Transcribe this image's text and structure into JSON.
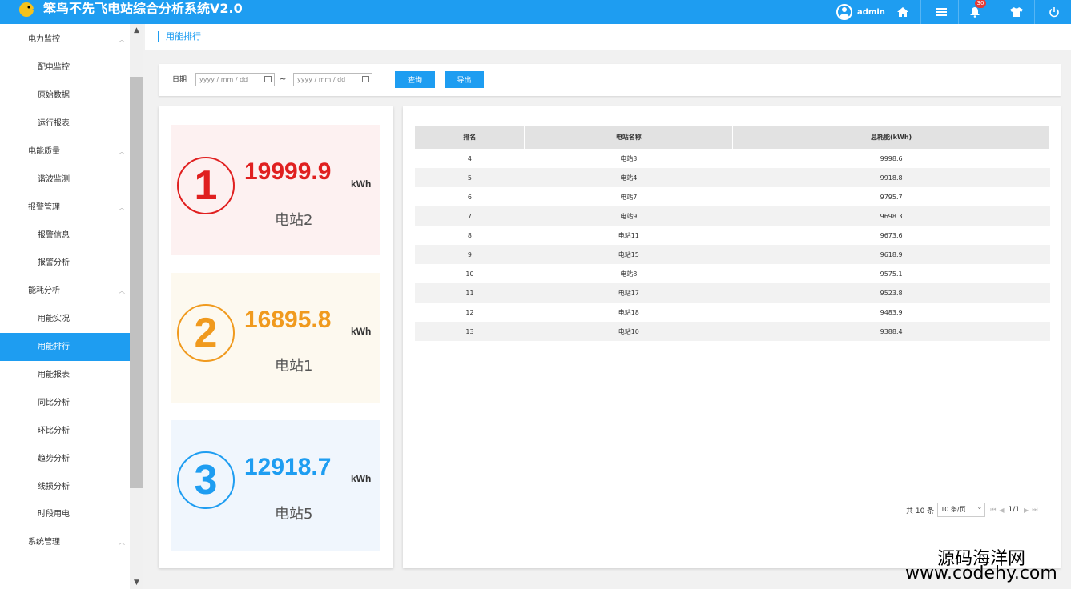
{
  "header": {
    "title": "笨鸟不先飞电站综合分析系统V2.0",
    "username": "admin",
    "notification_count": "30",
    "icons": [
      "logo-bird-icon",
      "user-avatar-icon",
      "home-icon",
      "menu-icon",
      "bell-icon",
      "shirt-icon",
      "power-icon"
    ]
  },
  "sidebar": {
    "items": [
      {
        "label": "电力监控",
        "type": "group"
      },
      {
        "label": "配电监控",
        "type": "item"
      },
      {
        "label": "原始数据",
        "type": "item"
      },
      {
        "label": "运行报表",
        "type": "item"
      },
      {
        "label": "电能质量",
        "type": "group"
      },
      {
        "label": "谐波监测",
        "type": "item"
      },
      {
        "label": "报警管理",
        "type": "group"
      },
      {
        "label": "报警信息",
        "type": "item"
      },
      {
        "label": "报警分析",
        "type": "item"
      },
      {
        "label": "能耗分析",
        "type": "group"
      },
      {
        "label": "用能实况",
        "type": "item"
      },
      {
        "label": "用能排行",
        "type": "item",
        "active": true
      },
      {
        "label": "用能报表",
        "type": "item"
      },
      {
        "label": "同比分析",
        "type": "item"
      },
      {
        "label": "环比分析",
        "type": "item"
      },
      {
        "label": "趋势分析",
        "type": "item"
      },
      {
        "label": "线损分析",
        "type": "item"
      },
      {
        "label": "时段用电",
        "type": "item"
      },
      {
        "label": "系统管理",
        "type": "group"
      }
    ]
  },
  "breadcrumb": "用能排行",
  "filter": {
    "date_label": "日期",
    "start_placeholder": "yyyy / mm / dd",
    "end_placeholder": "yyyy / mm / dd",
    "separator": "~",
    "query_button": "查询",
    "export_button": "导出"
  },
  "top_ranks": [
    {
      "rank": "1",
      "value": "19999.9",
      "unit": "kWh",
      "station": "电站2",
      "color": "#e02020",
      "bg": "#fdf1f1"
    },
    {
      "rank": "2",
      "value": "16895.8",
      "unit": "kWh",
      "station": "电站1",
      "color": "#f09a1e",
      "bg": "#fdf9ef"
    },
    {
      "rank": "3",
      "value": "12918.7",
      "unit": "kWh",
      "station": "电站5",
      "color": "#1e9df1",
      "bg": "#f0f6fd"
    }
  ],
  "table": {
    "headers": [
      "排名",
      "电站名称",
      "总耗能(kWh)"
    ],
    "rows": [
      [
        "4",
        "电站3",
        "9998.6"
      ],
      [
        "5",
        "电站4",
        "9918.8"
      ],
      [
        "6",
        "电站7",
        "9795.7"
      ],
      [
        "7",
        "电站9",
        "9698.3"
      ],
      [
        "8",
        "电站11",
        "9673.6"
      ],
      [
        "9",
        "电站15",
        "9618.9"
      ],
      [
        "10",
        "电站8",
        "9575.1"
      ],
      [
        "11",
        "电站17",
        "9523.8"
      ],
      [
        "12",
        "电站18",
        "9483.9"
      ],
      [
        "13",
        "电站10",
        "9388.4"
      ]
    ]
  },
  "pagination": {
    "total_text": "共 10 条",
    "page_size": "10 条/页",
    "page_indicator": "1/1"
  },
  "watermark": {
    "line1": "源码海洋网",
    "line2": "www.codehy.com"
  }
}
